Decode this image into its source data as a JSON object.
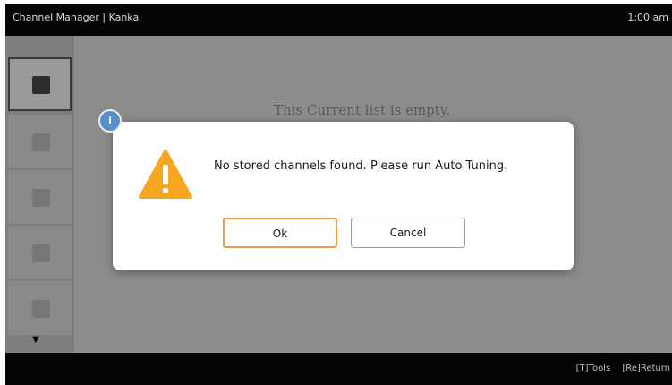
{
  "topbar": {
    "title": "Channel Manager | Kanka",
    "time": "1:00 am"
  },
  "sidebar": {
    "items": [
      "",
      "",
      "",
      "",
      ""
    ],
    "more_icon": "chevron-down-icon"
  },
  "main": {
    "empty_message": "This Current list is empty."
  },
  "dialog": {
    "info_badge": "i",
    "icon": "warning-triangle-icon",
    "message": "No stored channels found. Please run Auto Tuning.",
    "ok_label": "Ok",
    "cancel_label": "Cancel"
  },
  "bottombar": {
    "hint_tools": "[T]Tools",
    "hint_return": "[Re]Return"
  },
  "colors": {
    "accent": "#f09a47",
    "warning": "#f5a623",
    "info": "#5b8fc9",
    "overlay": "#8c8c8c",
    "bar": "#050505"
  }
}
